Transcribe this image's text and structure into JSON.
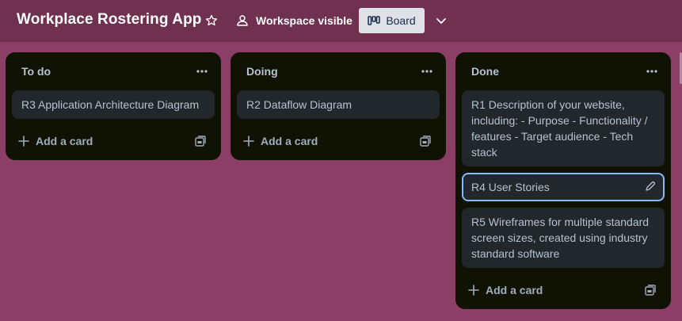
{
  "header": {
    "title": "Workplace Rostering App",
    "visibility_label": "Workspace visible",
    "view_label": "Board"
  },
  "lists": {
    "todo": {
      "title": "To do",
      "cards": [
        "R3 Application Architecture Diagram"
      ],
      "add_label": "Add a card"
    },
    "doing": {
      "title": "Doing",
      "cards": [
        "R2 Dataflow Diagram"
      ],
      "add_label": "Add a card"
    },
    "done": {
      "title": "Done",
      "cards": [
        "R1 Description of your website, including: - Purpose - Functionality / features - Target audience - Tech stack",
        "R4 User Stories",
        "R5 Wireframes for multiple standard screen sizes, created using industry standard software"
      ],
      "add_label": "Add a card"
    }
  },
  "colors": {
    "background": "#8b3f66",
    "topbar": "#70304f",
    "list": "#101204",
    "card": "#22272b",
    "focus": "#85b8ff"
  }
}
